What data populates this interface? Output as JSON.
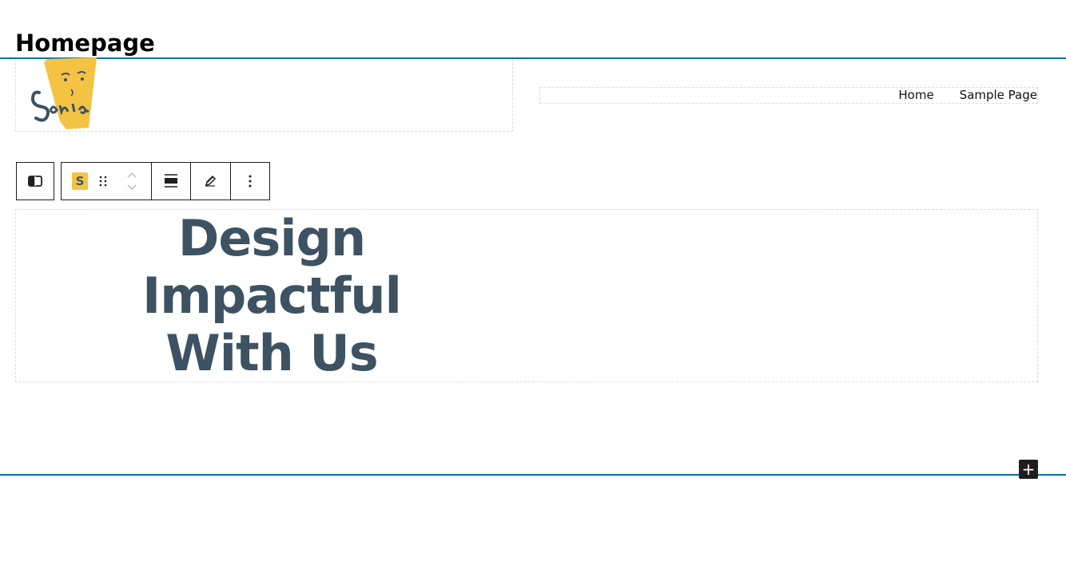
{
  "page": {
    "title": "Homepage"
  },
  "header": {
    "logo_icon": "sonia-logo",
    "nav": [
      {
        "label": "Home"
      },
      {
        "label": "Sample Page"
      }
    ]
  },
  "toolbar": {
    "select_parent_icon": "columns-icon",
    "block_type_badge": "S",
    "drag_icon": "drag-handle-icon",
    "move_up_icon": "chevron-up-icon",
    "move_down_icon": "chevron-down-icon",
    "align_icon": "align-center-icon",
    "edit_icon": "pencil-icon",
    "more_icon": "more-vertical-icon"
  },
  "content": {
    "heading_lines": [
      "Design",
      "Impactful",
      "With Us"
    ]
  },
  "inserter": {
    "label": "+"
  },
  "colors": {
    "accent": "#0073aa",
    "heading": "#3d5262",
    "logo_yellow": "#f5c343",
    "toolbar_border": "#1e1e1e"
  }
}
